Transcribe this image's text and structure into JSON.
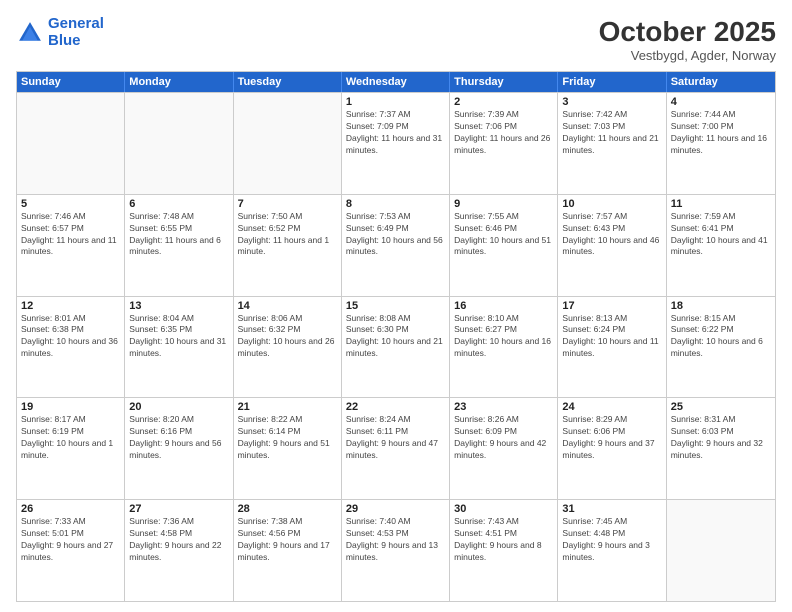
{
  "header": {
    "logo_line1": "General",
    "logo_line2": "Blue",
    "month_title": "October 2025",
    "location": "Vestbygd, Agder, Norway"
  },
  "days_of_week": [
    "Sunday",
    "Monday",
    "Tuesday",
    "Wednesday",
    "Thursday",
    "Friday",
    "Saturday"
  ],
  "rows": [
    [
      {
        "date": "",
        "info": ""
      },
      {
        "date": "",
        "info": ""
      },
      {
        "date": "",
        "info": ""
      },
      {
        "date": "1",
        "info": "Sunrise: 7:37 AM\nSunset: 7:09 PM\nDaylight: 11 hours and 31 minutes."
      },
      {
        "date": "2",
        "info": "Sunrise: 7:39 AM\nSunset: 7:06 PM\nDaylight: 11 hours and 26 minutes."
      },
      {
        "date": "3",
        "info": "Sunrise: 7:42 AM\nSunset: 7:03 PM\nDaylight: 11 hours and 21 minutes."
      },
      {
        "date": "4",
        "info": "Sunrise: 7:44 AM\nSunset: 7:00 PM\nDaylight: 11 hours and 16 minutes."
      }
    ],
    [
      {
        "date": "5",
        "info": "Sunrise: 7:46 AM\nSunset: 6:57 PM\nDaylight: 11 hours and 11 minutes."
      },
      {
        "date": "6",
        "info": "Sunrise: 7:48 AM\nSunset: 6:55 PM\nDaylight: 11 hours and 6 minutes."
      },
      {
        "date": "7",
        "info": "Sunrise: 7:50 AM\nSunset: 6:52 PM\nDaylight: 11 hours and 1 minute."
      },
      {
        "date": "8",
        "info": "Sunrise: 7:53 AM\nSunset: 6:49 PM\nDaylight: 10 hours and 56 minutes."
      },
      {
        "date": "9",
        "info": "Sunrise: 7:55 AM\nSunset: 6:46 PM\nDaylight: 10 hours and 51 minutes."
      },
      {
        "date": "10",
        "info": "Sunrise: 7:57 AM\nSunset: 6:43 PM\nDaylight: 10 hours and 46 minutes."
      },
      {
        "date": "11",
        "info": "Sunrise: 7:59 AM\nSunset: 6:41 PM\nDaylight: 10 hours and 41 minutes."
      }
    ],
    [
      {
        "date": "12",
        "info": "Sunrise: 8:01 AM\nSunset: 6:38 PM\nDaylight: 10 hours and 36 minutes."
      },
      {
        "date": "13",
        "info": "Sunrise: 8:04 AM\nSunset: 6:35 PM\nDaylight: 10 hours and 31 minutes."
      },
      {
        "date": "14",
        "info": "Sunrise: 8:06 AM\nSunset: 6:32 PM\nDaylight: 10 hours and 26 minutes."
      },
      {
        "date": "15",
        "info": "Sunrise: 8:08 AM\nSunset: 6:30 PM\nDaylight: 10 hours and 21 minutes."
      },
      {
        "date": "16",
        "info": "Sunrise: 8:10 AM\nSunset: 6:27 PM\nDaylight: 10 hours and 16 minutes."
      },
      {
        "date": "17",
        "info": "Sunrise: 8:13 AM\nSunset: 6:24 PM\nDaylight: 10 hours and 11 minutes."
      },
      {
        "date": "18",
        "info": "Sunrise: 8:15 AM\nSunset: 6:22 PM\nDaylight: 10 hours and 6 minutes."
      }
    ],
    [
      {
        "date": "19",
        "info": "Sunrise: 8:17 AM\nSunset: 6:19 PM\nDaylight: 10 hours and 1 minute."
      },
      {
        "date": "20",
        "info": "Sunrise: 8:20 AM\nSunset: 6:16 PM\nDaylight: 9 hours and 56 minutes."
      },
      {
        "date": "21",
        "info": "Sunrise: 8:22 AM\nSunset: 6:14 PM\nDaylight: 9 hours and 51 minutes."
      },
      {
        "date": "22",
        "info": "Sunrise: 8:24 AM\nSunset: 6:11 PM\nDaylight: 9 hours and 47 minutes."
      },
      {
        "date": "23",
        "info": "Sunrise: 8:26 AM\nSunset: 6:09 PM\nDaylight: 9 hours and 42 minutes."
      },
      {
        "date": "24",
        "info": "Sunrise: 8:29 AM\nSunset: 6:06 PM\nDaylight: 9 hours and 37 minutes."
      },
      {
        "date": "25",
        "info": "Sunrise: 8:31 AM\nSunset: 6:03 PM\nDaylight: 9 hours and 32 minutes."
      }
    ],
    [
      {
        "date": "26",
        "info": "Sunrise: 7:33 AM\nSunset: 5:01 PM\nDaylight: 9 hours and 27 minutes."
      },
      {
        "date": "27",
        "info": "Sunrise: 7:36 AM\nSunset: 4:58 PM\nDaylight: 9 hours and 22 minutes."
      },
      {
        "date": "28",
        "info": "Sunrise: 7:38 AM\nSunset: 4:56 PM\nDaylight: 9 hours and 17 minutes."
      },
      {
        "date": "29",
        "info": "Sunrise: 7:40 AM\nSunset: 4:53 PM\nDaylight: 9 hours and 13 minutes."
      },
      {
        "date": "30",
        "info": "Sunrise: 7:43 AM\nSunset: 4:51 PM\nDaylight: 9 hours and 8 minutes."
      },
      {
        "date": "31",
        "info": "Sunrise: 7:45 AM\nSunset: 4:48 PM\nDaylight: 9 hours and 3 minutes."
      },
      {
        "date": "",
        "info": ""
      }
    ]
  ]
}
